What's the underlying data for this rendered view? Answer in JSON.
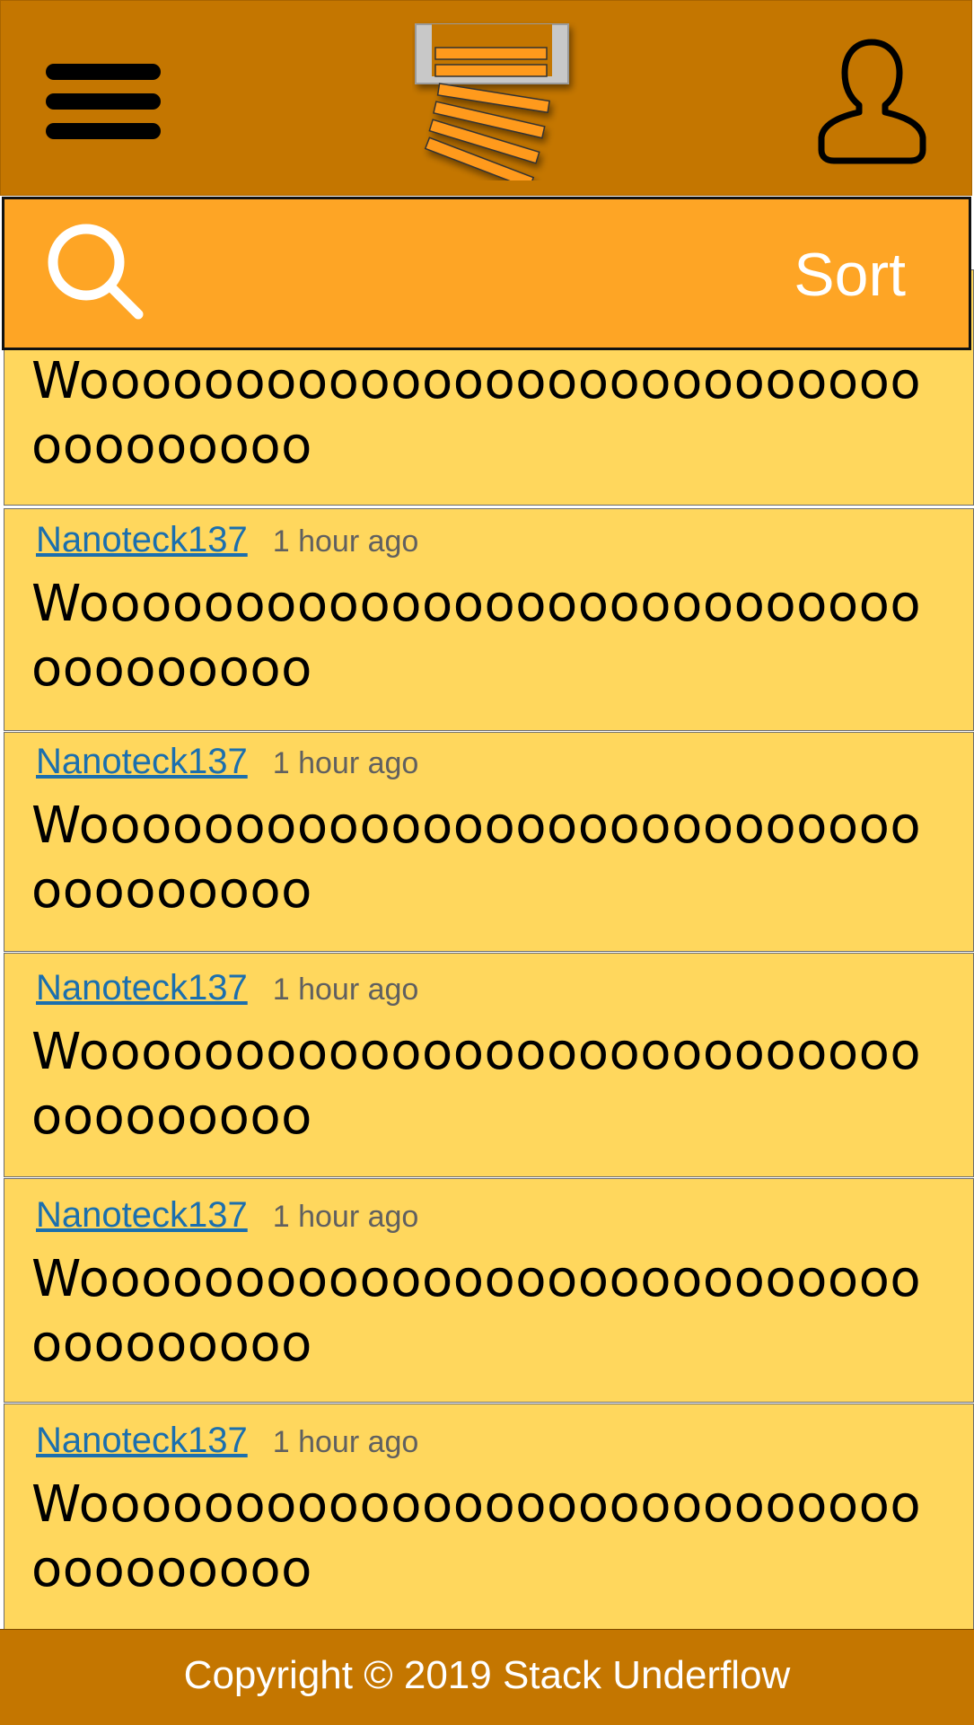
{
  "header": {
    "menu_icon": "hamburger-menu-icon",
    "logo_icon": "stack-underflow-logo",
    "profile_icon": "user-profile-icon"
  },
  "searchbar": {
    "search_icon": "search-icon",
    "sort_label": "Sort"
  },
  "posts": [
    {
      "author": "",
      "time": "",
      "text": "Woooooooooooooooooooooooooooooooooooo"
    },
    {
      "author": "Nanoteck137",
      "time": "1 hour ago",
      "text": "Woooooooooooooooooooooooooooooooooooo"
    },
    {
      "author": "Nanoteck137",
      "time": "1 hour ago",
      "text": "Woooooooooooooooooooooooooooooooooooo"
    },
    {
      "author": "Nanoteck137",
      "time": "1 hour ago",
      "text": "Woooooooooooooooooooooooooooooooooooo"
    },
    {
      "author": "Nanoteck137",
      "time": "1 hour ago",
      "text": "Woooooooooooooooooooooooooooooooooooo"
    },
    {
      "author": "Nanoteck137",
      "time": "1 hour ago",
      "text": "Woooooooooooooooooooooooooooooooooooo"
    }
  ],
  "footer": {
    "copyright": "Copyright © 2019 Stack Underflow"
  },
  "colors": {
    "header": "#c47600",
    "searchbar": "#fea525",
    "post_background": "#ffd75d",
    "author_link": "#1b6fae"
  }
}
